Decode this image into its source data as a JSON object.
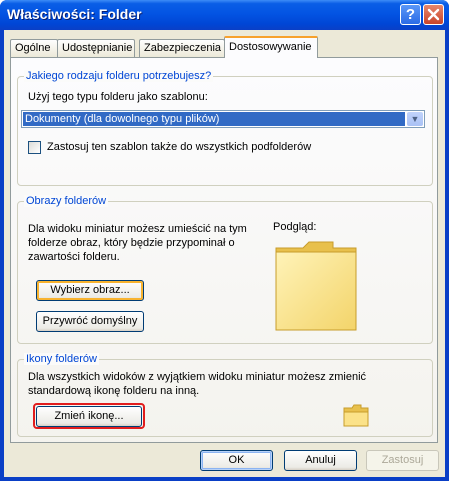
{
  "window": {
    "title": "Właściwości: Folder"
  },
  "tabs": [
    {
      "label": "Ogólne",
      "active": false
    },
    {
      "label": "Udostępnianie",
      "active": false
    },
    {
      "label": "Zabezpieczenia",
      "active": false
    },
    {
      "label": "Dostosowywanie",
      "active": true
    }
  ],
  "folder_type": {
    "group_title": "Jakiego rodzaju folderu potrzebujesz?",
    "template_label": "Użyj tego typu folderu jako szablonu:",
    "template_value": "Dokumenty (dla dowolnego typu plików)",
    "apply_subfolders_label": "Zastosuj ten szablon także do wszystkich podfolderów",
    "apply_subfolders_checked": false
  },
  "folder_pictures": {
    "group_title": "Obrazy folderów",
    "description_lines": [
      "Dla widoku miniatur możesz umieścić na tym",
      "folderze obraz, który będzie przypominał o",
      "zawartości folderu."
    ],
    "choose_button": "Wybierz obraz...",
    "restore_button": "Przywróć domyślny",
    "preview_label": "Podgląd:"
  },
  "folder_icons": {
    "group_title": "Ikony folderów",
    "description_lines": [
      "Dla wszystkich widoków z wyjątkiem widoku miniatur możesz zmienić",
      "standardową ikonę folderu na inną."
    ],
    "change_button": "Zmień ikonę..."
  },
  "footer": {
    "ok": "OK",
    "cancel": "Anuluj",
    "apply": "Zastosuj"
  },
  "colors": {
    "highlight": "#e11d1d",
    "group_title": "#0046d5",
    "selection": "#316ac5"
  },
  "icons": [
    "help-icon",
    "close-icon",
    "dropdown-arrow-icon",
    "folder-preview-icon",
    "folder-icon"
  ]
}
